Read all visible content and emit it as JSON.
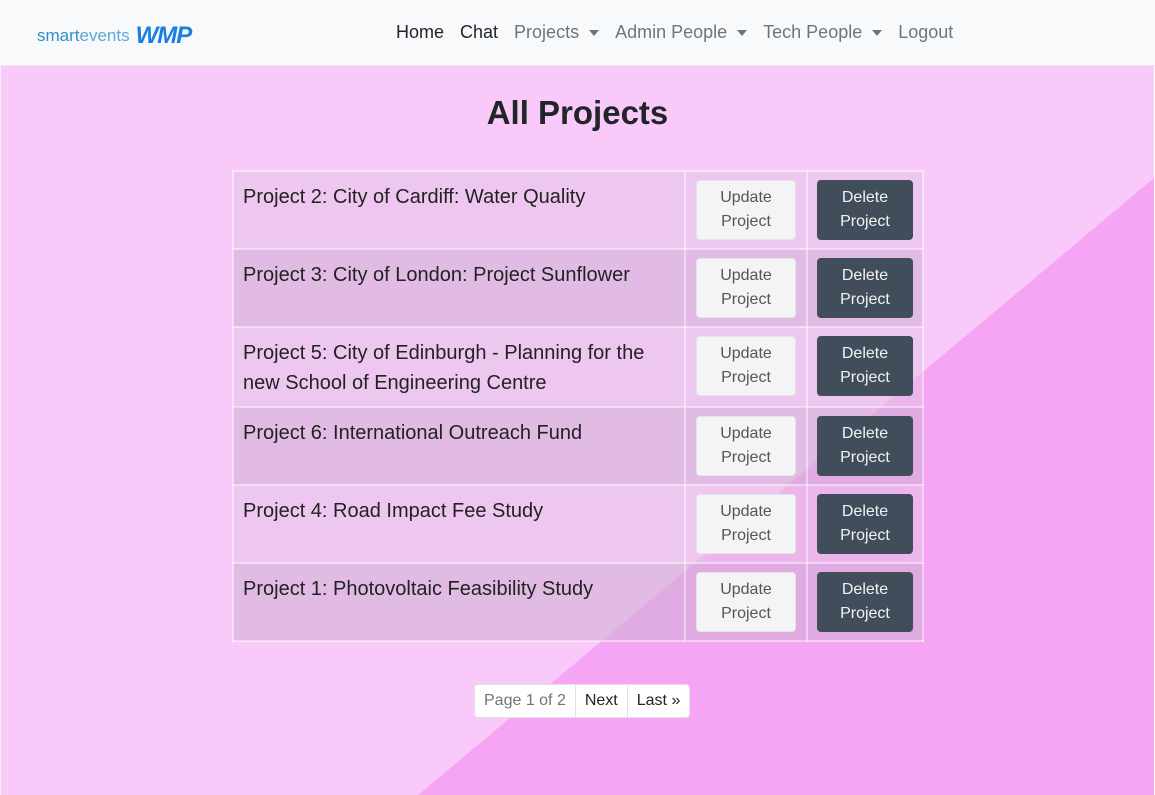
{
  "brand": {
    "smart": "smart",
    "events": "events",
    "wmp": "WMP"
  },
  "nav": {
    "home": "Home",
    "chat": "Chat",
    "projects": "Projects",
    "admin_people": "Admin People",
    "tech_people": "Tech People",
    "logout": "Logout"
  },
  "page": {
    "title": "All Projects"
  },
  "projects": [
    {
      "name": "Project 2: City of Cardiff: Water Quality",
      "update_label": "Update Project",
      "delete_label": "Delete Project"
    },
    {
      "name": "Project 3: City of London: Project Sunflower",
      "update_label": "Update Project",
      "delete_label": "Delete Project"
    },
    {
      "name": "Project 5: City of Edinburgh - Planning for the new School of Engineering Centre",
      "update_label": "Update Project",
      "delete_label": "Delete Project"
    },
    {
      "name": "Project 6: International Outreach Fund",
      "update_label": "Update Project",
      "delete_label": "Delete Project"
    },
    {
      "name": "Project 4: Road Impact Fee Study",
      "update_label": "Update Project",
      "delete_label": "Delete Project"
    },
    {
      "name": "Project 1: Photovoltaic Feasibility Study",
      "update_label": "Update Project",
      "delete_label": "Delete Project"
    }
  ],
  "pagination": {
    "current": "Page 1 of 2",
    "next": "Next",
    "last": "Last »"
  },
  "colors": {
    "background_light": "#f9caf9",
    "background_dark": "#f6a5f4",
    "delete_button": "#424d5c",
    "brand_blue": "#1a7fe0"
  }
}
